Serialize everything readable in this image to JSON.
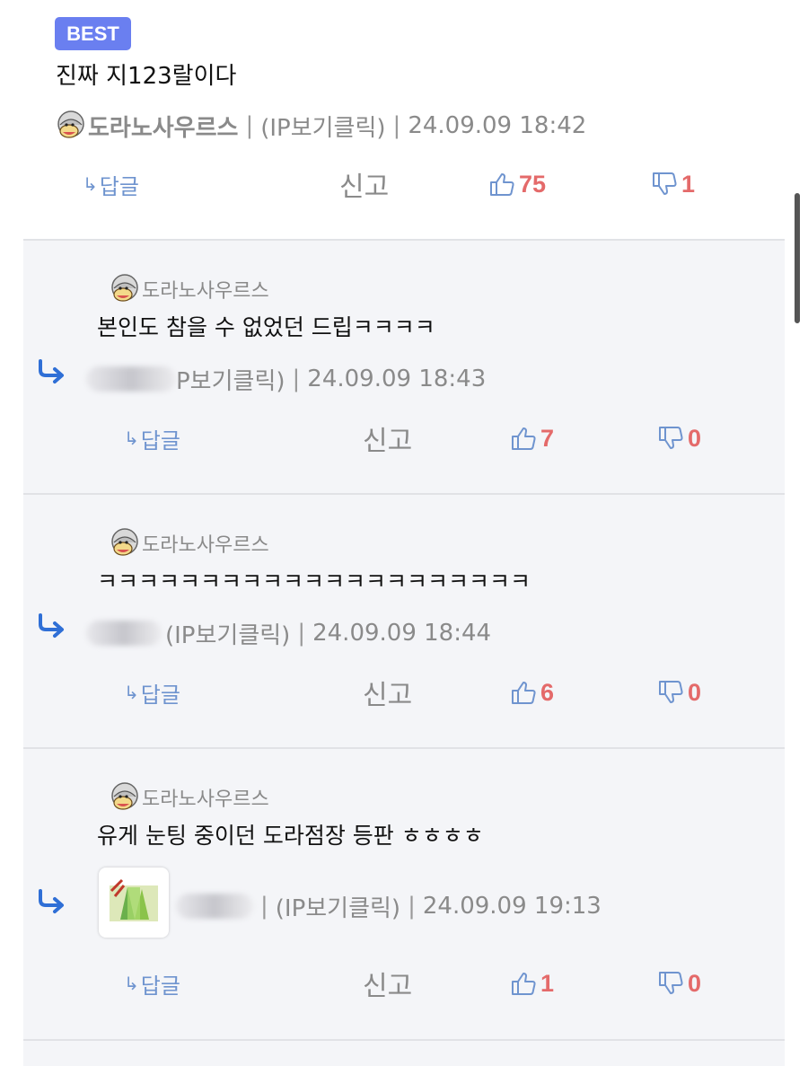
{
  "best": {
    "badge": "BEST",
    "text": "진짜 지123랄이다",
    "nick": "도라노사우르스",
    "ip_label": "(IP보기클릭)",
    "date": "24.09.09 18:42",
    "reply_label": "답글",
    "report_label": "신고",
    "up": "75",
    "down": "1"
  },
  "replies": [
    {
      "nick": "도라노사우르스",
      "text": "본인도 참을 수 없었던 드립ㅋㅋㅋㅋ",
      "ip_label": "P보기클릭)",
      "date": "24.09.09 18:43",
      "reply_label": "답글",
      "report_label": "신고",
      "up": "7",
      "down": "0"
    },
    {
      "nick": "도라노사우르스",
      "text": "ㅋㅋㅋㅋㅋㅋㅋㅋㅋㅋㅋㅋㅋㅋㅋㅋㅋㅋㅋㅋㅋ",
      "ip_label": "(IP보기클릭)",
      "date": "24.09.09 18:44",
      "reply_label": "답글",
      "report_label": "신고",
      "up": "6",
      "down": "0"
    },
    {
      "nick": "도라노사우르스",
      "text": "유게 눈팅 중이던 도라점장 등판 ㅎㅎㅎㅎ",
      "ip_label": "(IP보기클릭)",
      "date": "24.09.09 19:13",
      "reply_label": "답글",
      "report_label": "신고",
      "up": "1",
      "down": "0"
    }
  ],
  "separator": "|",
  "colors": {
    "badge": "#6a7ff0",
    "vote": "#e46a6a",
    "link": "#6f94cf",
    "reply_bg": "#f4f5f8"
  },
  "icons": [
    "reply-arrow-icon",
    "thumbs-up-icon",
    "thumbs-down-icon",
    "avatar-icon",
    "sticker-icon"
  ]
}
